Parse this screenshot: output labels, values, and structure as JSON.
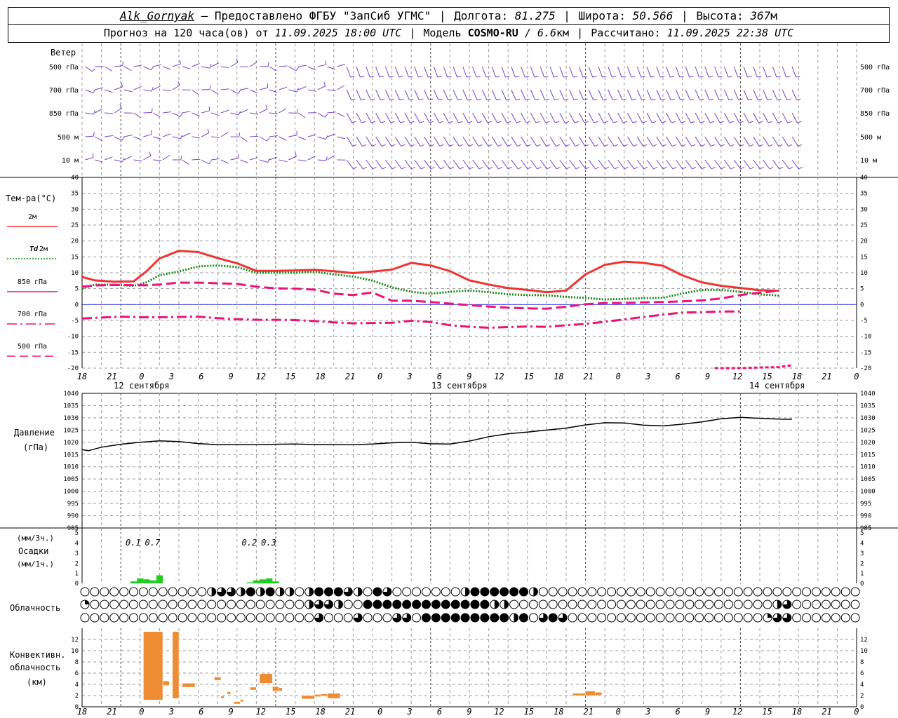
{
  "header": {
    "station": "Alk_Gornyak",
    "provider": "– Предоставлено ФГБУ \"ЗапСиб УГМС\"",
    "lon_label": "Долгота:",
    "lon_value": "81.275",
    "lat_label": "Широта:",
    "lat_value": "50.566",
    "alt_label": "Высота:",
    "alt_value": "367",
    "alt_unit": "м",
    "forecast_label": "Прогноз на 120 часа(ов) от",
    "forecast_start": "11.09.2025 18:00 UTC",
    "model_label": "Модель",
    "model_name": "COSMO-RU",
    "model_res": "/ 6.6",
    "model_res_unit": "км",
    "calc_label": "Рассчитано:",
    "calc_time": "11.09.2025 22:38 UTC"
  },
  "colors": {
    "t2m": "#ee3333",
    "td2m": "#1a8c1a",
    "t850": "#ee1177",
    "t700": "#ee1177",
    "t500": "#ee1177",
    "wind": "#7a3fcf",
    "pressure": "#000000",
    "precip": "#22cc22",
    "convective": "#ee8c33",
    "zero_line": "#4444ee",
    "grid": "#9a9a9a"
  },
  "time_axis": {
    "ticks": [
      "18",
      "21",
      "0",
      "3",
      "6",
      "9",
      "12",
      "15",
      "18",
      "21",
      "0",
      "3",
      "6",
      "9",
      "12",
      "15",
      "18",
      "21",
      "0",
      "3",
      "6",
      "9",
      "12",
      "15",
      "18",
      "21",
      "0"
    ],
    "days": [
      {
        "label": "12 сентября",
        "hour_index": 9
      },
      {
        "label": "13 сентября",
        "hour_index": 57
      },
      {
        "label": "14 сентября",
        "hour_index": 105
      }
    ]
  },
  "wind_panel": {
    "title": "Ветер",
    "levels": [
      "500 гПа",
      "700 гПа",
      "850 гПа",
      "500 м",
      "10 м"
    ]
  },
  "temp_panel": {
    "title": "Тем-ра(°C)",
    "legend": [
      {
        "label": "2м",
        "series": "t2m",
        "style": "solid"
      },
      {
        "label_prefix": "Td",
        "label": "2м",
        "series": "td2m",
        "style": "dotted"
      },
      {
        "label": "850 гПа",
        "series": "t850",
        "style": "solid"
      },
      {
        "label": "700 гПа",
        "series": "t700",
        "style": "dashdot"
      },
      {
        "label": "500 гПа",
        "series": "t500",
        "style": "dashed"
      }
    ],
    "ticks": [
      "40",
      "35",
      "30",
      "25",
      "20",
      "15",
      "10",
      "5",
      "0",
      "-5",
      "-10",
      "-15",
      "-20"
    ]
  },
  "pressure_panel": {
    "title": "Давление",
    "unit": "(гПа)",
    "ticks": [
      "1040",
      "1035",
      "1030",
      "1025",
      "1020",
      "1015",
      "1010",
      "1005",
      "1000",
      "995",
      "990",
      "985"
    ]
  },
  "precip_panel": {
    "unit1": "(мм/3ч.)",
    "title": "Осадки",
    "unit2": "(мм/1ч.)",
    "ticks": [
      "5",
      "4",
      "3",
      "2",
      "1",
      "0"
    ],
    "totals": [
      {
        "hour": 9,
        "text": "0.1"
      },
      {
        "hour": 12,
        "text": "0.7"
      },
      {
        "hour": 27,
        "text": "0.2"
      },
      {
        "hour": 30,
        "text": "0.3"
      }
    ]
  },
  "cloud_panel": {
    "title": "Облачность"
  },
  "conv_panel": {
    "title1": "Конвективн.",
    "title2": "облачность",
    "unit": "(км)",
    "ticks": [
      "12",
      "10",
      "8",
      "6",
      "4",
      "2",
      "0"
    ]
  },
  "chart_data": [
    {
      "type": "line",
      "name": "temperature",
      "x_hours_from_start": [
        0,
        3,
        6,
        9,
        12,
        15,
        18,
        21,
        24,
        27,
        30,
        33,
        36,
        39,
        42,
        45,
        48,
        51,
        54,
        57,
        60,
        63,
        66,
        69,
        72,
        75,
        78,
        81,
        84,
        87,
        90,
        93,
        96,
        99,
        102,
        105,
        108,
        111,
        114,
        117,
        120
      ],
      "ylim": [
        -20,
        40
      ],
      "series": [
        {
          "name": "2м",
          "key": "t2m",
          "values": [
            8.7,
            7.6,
            7.2,
            7.3,
            10.5,
            14.5,
            16.9,
            16.5,
            14.6,
            13,
            10.6,
            10.6,
            10.7,
            10.9,
            10.5,
            9.9,
            10.4,
            11,
            13.1,
            12.3,
            10.5,
            7.6,
            6.3,
            5.2,
            4.6,
            3.9,
            4.4,
            9.5,
            12.5,
            13.5,
            13.1,
            12.2,
            9.2,
            7,
            5.9,
            5.2,
            4.5,
            4.3
          ]
        },
        {
          "name": "Td 2м",
          "key": "td2m",
          "values": [
            5,
            6.3,
            6.2,
            5.9,
            7,
            9.2,
            10.4,
            12,
            12.3,
            11.8,
            10,
            10,
            10,
            10.3,
            9.5,
            8.8,
            7.5,
            5.4,
            4,
            3.4,
            4,
            4.4,
            3.9,
            3.2,
            3,
            2.9,
            2.4,
            2.1,
            1.6,
            1.8,
            2,
            2.1,
            3.5,
            4.6,
            4.6,
            4,
            3.2,
            2.8
          ]
        },
        {
          "name": "850 гПа",
          "key": "t850",
          "values": [
            5.6,
            6,
            6.2,
            6.1,
            6.1,
            6.3,
            6.9,
            6.9,
            6.7,
            6.5,
            5.6,
            5.1,
            5,
            4.7,
            3.4,
            3,
            3.8,
            1.2,
            1.2,
            0.8,
            0.3,
            -0.2,
            -0.6,
            -1,
            -1.2,
            -1.3,
            -0.7,
            0.1,
            0.5,
            0.5,
            0.7,
            0.8,
            1,
            1.3,
            1.9,
            3,
            3.7,
            4.4
          ]
        },
        {
          "name": "700 гПа",
          "key": "t700",
          "values": [
            -4.4,
            -4.1,
            -3.8,
            -4,
            -4,
            -3.9,
            -3.8,
            -4.3,
            -4.6,
            -4.8,
            -4.8,
            -4.9,
            -5.2,
            -5.6,
            -5.9,
            -5.8,
            -5.7,
            -5.1,
            -5.5,
            -6.5,
            -7,
            -7.3,
            -7.1,
            -6.9,
            -7,
            -6.5,
            -6.1,
            -5.4,
            -4.7,
            -3.9,
            -3.2,
            -2.5,
            -2.4,
            -2.2,
            -2.2
          ]
        },
        {
          "name": "500 гПа",
          "key": "t500",
          "values": [
            -20,
            -20,
            -19.8,
            -19.7,
            -19.1
          ]
        }
      ],
      "series_hours": {
        "t2m": [
          0,
          2,
          5,
          8,
          10,
          12,
          15,
          18,
          21,
          24,
          27,
          30,
          33,
          36,
          39,
          42,
          45,
          48,
          51,
          54,
          57,
          60,
          63,
          66,
          69,
          72,
          75,
          78,
          81,
          84,
          87,
          90,
          93,
          96,
          99,
          102,
          105,
          108
        ],
        "td2m": [
          0,
          2,
          5,
          8,
          10,
          12,
          15,
          18,
          21,
          24,
          27,
          30,
          33,
          36,
          39,
          42,
          45,
          48,
          51,
          54,
          57,
          60,
          63,
          66,
          69,
          72,
          75,
          78,
          81,
          84,
          87,
          90,
          93,
          96,
          99,
          102,
          105,
          108
        ],
        "t850": [
          0,
          2,
          5,
          8,
          10,
          12,
          15,
          18,
          21,
          24,
          27,
          30,
          33,
          36,
          39,
          42,
          45,
          48,
          51,
          54,
          57,
          60,
          63,
          66,
          69,
          72,
          75,
          78,
          81,
          84,
          87,
          90,
          93,
          96,
          99,
          102,
          105,
          108
        ],
        "t700": [
          0,
          3,
          6,
          9,
          12,
          15,
          18,
          21,
          24,
          27,
          30,
          33,
          36,
          39,
          42,
          45,
          48,
          51,
          54,
          57,
          60,
          63,
          66,
          69,
          72,
          75,
          78,
          81,
          84,
          87,
          90,
          93,
          96,
          99,
          102
        ],
        "t500": [
          98,
          102,
          105,
          108,
          110
        ]
      }
    },
    {
      "type": "line",
      "name": "pressure",
      "series": [
        {
          "name": "Давление",
          "values": [
            1017,
            1016.6,
            1018,
            1019.2,
            1020,
            1020.6,
            1020.3,
            1019.5,
            1019,
            1019,
            1019,
            1019.2,
            1019.3,
            1019.1,
            1019,
            1019,
            1019.3,
            1019.8,
            1020,
            1019.4,
            1019.3,
            1020.5,
            1022.3,
            1023.5,
            1024.2,
            1025,
            1025.8,
            1027.1,
            1028,
            1027.9,
            1027,
            1026.7,
            1027.4,
            1028.3,
            1029.6,
            1030.2,
            1029.8,
            1029.5,
            1029.4
          ]
        }
      ],
      "x_hours_from_start": [
        0,
        1,
        3,
        6,
        9,
        12,
        15,
        18,
        21,
        24,
        27,
        30,
        33,
        36,
        39,
        42,
        45,
        48,
        51,
        54,
        57,
        60,
        63,
        66,
        69,
        72,
        75,
        78,
        81,
        84,
        87,
        90,
        93,
        96,
        99,
        102,
        105,
        108,
        110
      ],
      "ylim": [
        985,
        1040
      ]
    },
    {
      "type": "bar",
      "name": "precipitation_1h",
      "x_hours_from_start": [
        8,
        9,
        10,
        11,
        12,
        26,
        27,
        28,
        29,
        30
      ],
      "values": [
        0.2,
        0.5,
        0.4,
        0.3,
        0.8,
        0.1,
        0.3,
        0.4,
        0.5,
        0.2
      ],
      "ylim": [
        0,
        5
      ]
    },
    {
      "type": "bar",
      "name": "convective_cloud",
      "ylim": [
        0,
        13
      ],
      "segments": [
        {
          "h0": 9.5,
          "h1": 12.5,
          "base": 1.2,
          "top": 13.5
        },
        {
          "h0": 12.5,
          "h1": 13.5,
          "base": 3.8,
          "top": 4.6
        },
        {
          "h0": 14,
          "h1": 15,
          "base": 1.5,
          "top": 13.5
        },
        {
          "h0": 15.5,
          "h1": 17.5,
          "base": 3.5,
          "top": 4.2
        },
        {
          "h0": 20.5,
          "h1": 21.5,
          "base": 4.7,
          "top": 5.3
        },
        {
          "h0": 21.5,
          "h1": 22,
          "base": 1.5,
          "top": 1.9
        },
        {
          "h0": 22.5,
          "h1": 23,
          "base": 2.2,
          "top": 2.7
        },
        {
          "h0": 23.5,
          "h1": 24.5,
          "base": 0.5,
          "top": 0.9
        },
        {
          "h0": 24.5,
          "h1": 25,
          "base": 0.9,
          "top": 1.3
        },
        {
          "h0": 26,
          "h1": 27,
          "base": 3.0,
          "top": 3.5
        },
        {
          "h0": 27.5,
          "h1": 29.5,
          "base": 4.2,
          "top": 5.9
        },
        {
          "h0": 29.5,
          "h1": 30.5,
          "base": 2.8,
          "top": 3.6
        },
        {
          "h0": 30.5,
          "h1": 31,
          "base": 2.8,
          "top": 3.4
        },
        {
          "h0": 34,
          "h1": 36,
          "base": 1.4,
          "top": 2.0
        },
        {
          "h0": 36,
          "h1": 37,
          "base": 1.8,
          "top": 2.2
        },
        {
          "h0": 37,
          "h1": 38,
          "base": 1.9,
          "top": 2.3
        },
        {
          "h0": 38,
          "h1": 40,
          "base": 1.5,
          "top": 2.4
        },
        {
          "h0": 76,
          "h1": 78,
          "base": 2.0,
          "top": 2.4
        },
        {
          "h0": 78,
          "h1": 79.5,
          "base": 2.0,
          "top": 2.8
        },
        {
          "h0": 79.5,
          "h1": 80.5,
          "base": 2.0,
          "top": 2.6
        }
      ]
    }
  ],
  "cloud_rows": [
    "ooooooooooooohHHhFhFhhohFFFHhoFHooooooohFFFFFFhooooooooooooooooooooooooooooooooooo",
    "qoooooooooooooooooooooohHHhooFFFFFFFFFFFFFhhooooooooooooooooooooooooooohHooooooooooo",
    "ooooooooooooooooooooooooHoooHoooHHoFFFFFFFFFhFoHFHooooooooooooooooooooqHHooooooooooo"
  ]
}
